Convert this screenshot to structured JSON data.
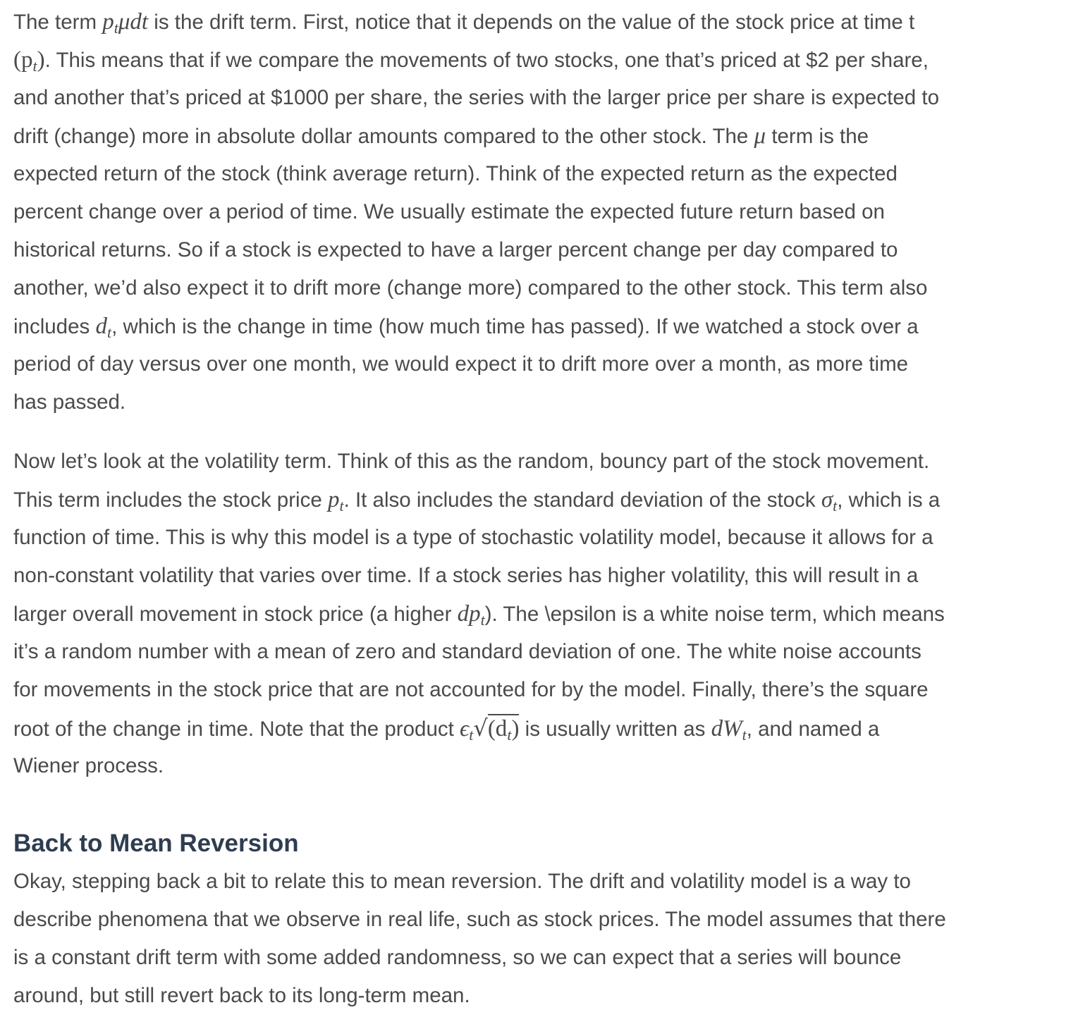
{
  "paragraph_1": {
    "line_1": {
      "a": "The term ",
      "math": "p",
      "math_sub": "t",
      "math2": "μdt",
      "b": " is the drift term. First, notice that it depends on the value of the stock price at time t"
    },
    "line_2": {
      "math_open": "(p",
      "math_sub": "t",
      "math_close": ")",
      "b": ". This means that if we compare the movements of two stocks, one that’s priced at $2 per share,"
    },
    "line_3": "and another that’s priced at $1000 per share, the series with the larger price per share is expected to",
    "line_4": {
      "a": "drift (change) more in absolute dollar amounts compared to the other stock. The ",
      "math": "μ",
      "b": " term is the"
    },
    "line_5": "expected return of the stock (think average return). Think of the expected return as the expected",
    "line_6": "percent change over a period of time. We usually estimate the expected future return based on",
    "line_7": "historical returns. So if a stock is expected to have a larger percent change per day compared to",
    "line_8": "another, we’d also expect it to drift more (change more) compared to the other stock. This term also",
    "line_9": {
      "a": "includes ",
      "math": "d",
      "math_sub": "t",
      "b": ", which is the change in time (how much time has passed). If we watched a stock over a"
    },
    "line_10": "period of day versus over one month, we would expect it to drift more over a month, as more time",
    "line_11": "has passed."
  },
  "paragraph_2": {
    "line_1": "Now let’s look at the volatility term. Think of this as the random, bouncy part of the stock movement.",
    "line_2": {
      "a": "This term includes the stock price ",
      "math": "p",
      "math_sub": "t",
      "b": ". It also includes the standard deviation of the stock ",
      "math2": "σ",
      "math2_sub": "t",
      "c": ", which is a"
    },
    "line_3": "function of time. This is why this model is a type of stochastic volatility model, because it allows for a",
    "line_4": "non-constant volatility that varies over time. If a stock series has higher volatility, this will result in a",
    "line_5": {
      "a": "larger overall movement in stock price (a higher ",
      "math": "dp",
      "math_sub": "t",
      "b": "). The \\epsilon is a white noise term, which means"
    },
    "line_6": "it’s a random number with a mean of zero and standard deviation of one. The white noise accounts",
    "line_7": "for movements in the stock price that are not accounted for by the model. Finally, there’s the square",
    "line_8": {
      "a": "root of the change in time. Note that the product ",
      "math_eps": "ϵ",
      "math_eps_sub": "t",
      "math_sqrt": "√",
      "math_paren_open": "(d",
      "math_paren_sub": "t",
      "math_paren_close": ")",
      "b": " is usually written as ",
      "math2": "dW",
      "math2_sub": "t",
      "c": ", and named a"
    },
    "line_9": "Wiener process."
  },
  "section_heading": "Back to Mean Reversion",
  "paragraph_3": {
    "line_1": "Okay, stepping back a bit to relate this to mean reversion. The drift and volatility model is a way to",
    "line_2": "describe phenomena that we observe in real life, such as stock prices. The model assumes that there",
    "line_3": "is a constant drift term with some added randomness, so we can expect that a series will bounce",
    "line_4": "around, but still revert back to its long-term mean."
  },
  "colors": {
    "body_text": "#4a4a4a",
    "heading_text": "#2e3d4f",
    "background": "#ffffff"
  }
}
